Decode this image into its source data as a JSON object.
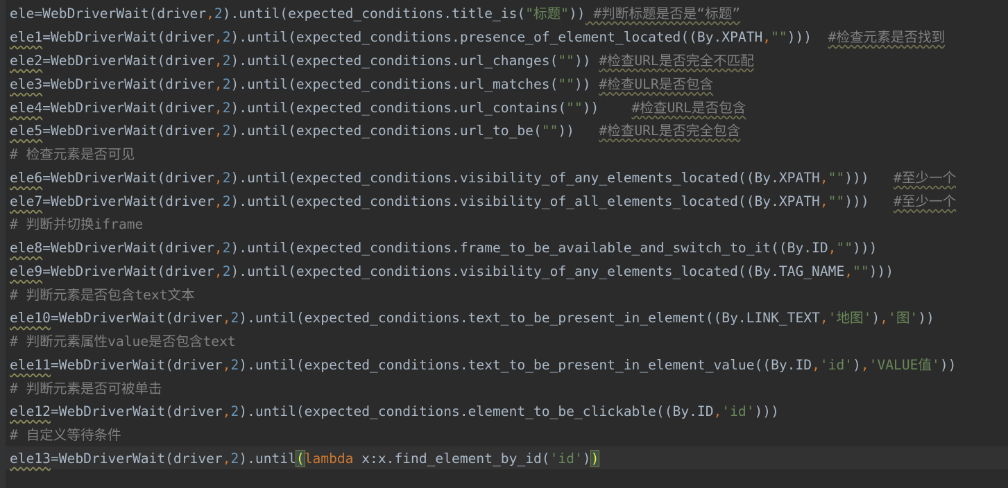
{
  "editor": {
    "lines": [
      {
        "var": "ele",
        "call": "=WebDriverWait(driver",
        "sep": ",",
        "num": "2",
        "rest": ").until(expected_conditions.title_is(",
        "str": "\"标题\"",
        "end": "))",
        "comment": " #判断标题是否是“标题”"
      },
      {
        "var": "ele1",
        "call": "=WebDriverWait(driver",
        "sep": ",",
        "num": "2",
        "rest": ").until(expected_conditions.presence_of_element_located((By.XPATH",
        "sep2": ",",
        "str": "\"\"",
        "end": ")))  ",
        "comment": "#检查元素是否找到"
      },
      {
        "var": "ele2",
        "call": "=WebDriverWait(driver",
        "sep": ",",
        "num": "2",
        "rest": ").until(expected_conditions.url_changes(",
        "str": "\"\"",
        "end": ")) ",
        "comment": "#检查URL是否完全不匹配"
      },
      {
        "var": "ele3",
        "call": "=WebDriverWait(driver",
        "sep": ",",
        "num": "2",
        "rest": ").until(expected_conditions.url_matches(",
        "str": "\"\"",
        "end": ")) ",
        "comment": "#检查ULR是否包含"
      },
      {
        "var": "ele4",
        "call": "=WebDriverWait(driver",
        "sep": ",",
        "num": "2",
        "rest": ").until(expected_conditions.url_contains(",
        "str": "\"\"",
        "end": "))    ",
        "comment": "#检查URL是否包含"
      },
      {
        "var": "ele5",
        "call": "=WebDriverWait(driver",
        "sep": ",",
        "num": "2",
        "rest": ").until(expected_conditions.url_to_be(",
        "str": "\"\"",
        "end": "))   ",
        "comment": "#检查URL是否完全包含"
      },
      {
        "comment": "# 检查元素是否可见"
      },
      {
        "var": "ele6",
        "call": "=WebDriverWait(driver",
        "sep": ",",
        "num": "2",
        "rest": ").until(expected_conditions.visibility_of_any_elements_located((By.XPATH",
        "sep2": ",",
        "str": "\"\"",
        "end": ")))   ",
        "comment": "#至少一个"
      },
      {
        "var": "ele7",
        "call": "=WebDriverWait(driver",
        "sep": ",",
        "num": "2",
        "rest": ").until(expected_conditions.visibility_of_all_elements_located((By.XPATH",
        "sep2": ",",
        "str": "\"\"",
        "end": ")))   ",
        "comment": "#至少一个"
      },
      {
        "comment": "# 判断并切换iframe"
      },
      {
        "var": "ele8",
        "call": "=WebDriverWait(driver",
        "sep": ",",
        "num": "2",
        "rest": ").until(expected_conditions.frame_to_be_available_and_switch_to_it((By.ID",
        "sep2": ",",
        "str": "\"\"",
        "end": ")))"
      },
      {
        "var": "ele9",
        "call": "=WebDriverWait(driver",
        "sep": ",",
        "num": "2",
        "rest": ").until(expected_conditions.visibility_of_any_elements_located((By.TAG_NAME",
        "sep2": ",",
        "str": "\"\"",
        "end": ")))"
      },
      {
        "comment": "# 判断元素是否包含text文本"
      },
      {
        "var": "ele10",
        "call": "=WebDriverWait(driver",
        "sep": ",",
        "num": "2",
        "rest": ").until(expected_conditions.text_to_be_present_in_element((By.LINK_TEXT",
        "sep2": ",",
        "str": "'地图'",
        "mid": ")",
        "sep3": ",",
        "str2": "'图'",
        "end": "))"
      },
      {
        "comment": "# 判断元素属性value是否包含text"
      },
      {
        "var": "ele11",
        "call": "=WebDriverWait(driver",
        "sep": ",",
        "num": "2",
        "rest": ").until(expected_conditions.text_to_be_present_in_element_value((By.ID",
        "sep2": ",",
        "str": "'id'",
        "mid": ")",
        "sep3": ",",
        "str2": "'VALUE值'",
        "end": "))"
      },
      {
        "comment": "# 判断元素是否可被单击"
      },
      {
        "var": "ele12",
        "call": "=WebDriverWait(driver",
        "sep": ",",
        "num": "2",
        "rest": ").until(expected_conditions.element_to_be_clickable((By.ID",
        "sep2": ",",
        "str": "'id'",
        "end": ")))"
      },
      {
        "comment": "# 自定义等待条件"
      },
      {
        "var": "ele13",
        "call": "=WebDriverWait(driver",
        "sep": ",",
        "num": "2",
        "rest": ").until",
        "open": "(",
        "kw": "lambda",
        "rest2": " x:x.find_element_by_id(",
        "str": "'id'",
        "mid": ")",
        "close": ")"
      }
    ]
  }
}
